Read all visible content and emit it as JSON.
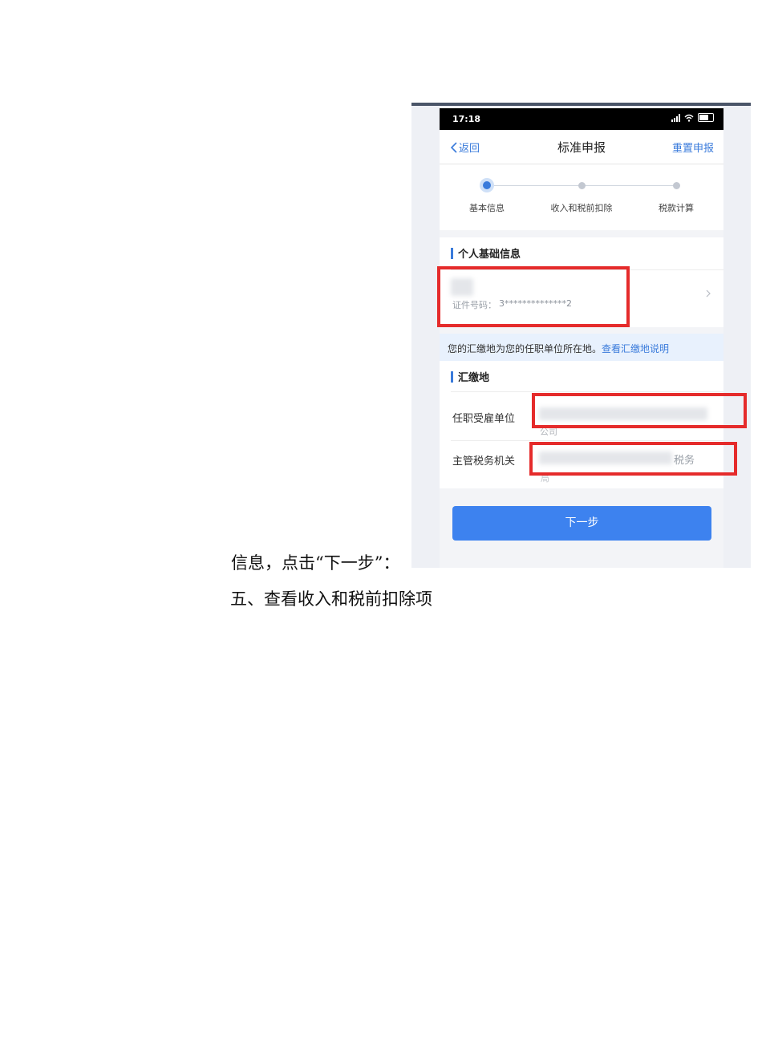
{
  "document": {
    "line_1": "信息，点击“下一步”：",
    "heading": "五、查看收入和税前扣除项"
  },
  "screenshot": {
    "status_bar": {
      "time": "17:18"
    },
    "nav": {
      "back_label": "返回",
      "title": "标准申报",
      "reset_label": "重置申报"
    },
    "steps": [
      {
        "label": "基本信息",
        "active": true
      },
      {
        "label": "收入和税前扣除",
        "active": false
      },
      {
        "label": "税款计算",
        "active": false
      }
    ],
    "personal_info": {
      "section_title": "个人基础信息",
      "id_label": "证件号码：",
      "id_number": "3**************2"
    },
    "notice": {
      "text": "您的汇缴地为您的任职单位所在地。",
      "link": "查看汇缴地说明"
    },
    "payment_location": {
      "section_title": "汇缴地",
      "employer_label": "任职受雇单位",
      "employer_value_tail": "公司",
      "tax_office_label": "主管税务机关",
      "tax_office_value_tail": "税务",
      "tax_office_value_line2": "局"
    },
    "next_button": "下一步",
    "colors": {
      "accent": "#3d82ef",
      "highlight": "#e52b2b"
    }
  }
}
